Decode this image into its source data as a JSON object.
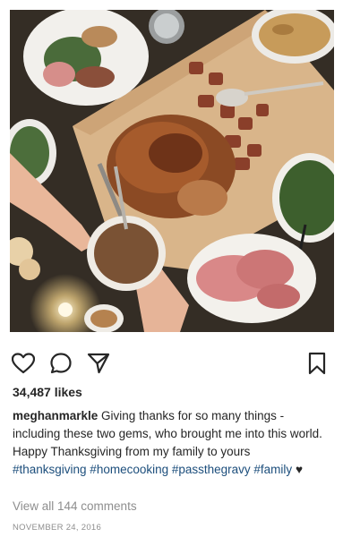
{
  "post": {
    "likes": "34,487 likes",
    "username": "meghanmarkle",
    "caption_text": " Giving thanks for so many things - including these two gems, who brought me into this world. Happy Thanksgiving from my family to yours",
    "hashtags": "#thanksgiving #homecooking #passthegravy #family",
    "caption_emoji": " ♥",
    "view_comments": "View all 144 comments",
    "date": "NOVEMBER 24, 2016"
  },
  "icons": {
    "like": "heart-outline-icon",
    "comment": "speech-bubble-icon",
    "share": "paper-plane-icon",
    "save": "bookmark-icon"
  },
  "colors": {
    "text": "#262626",
    "hashtag": "#1c4e7c",
    "muted": "#8e8e8e"
  }
}
